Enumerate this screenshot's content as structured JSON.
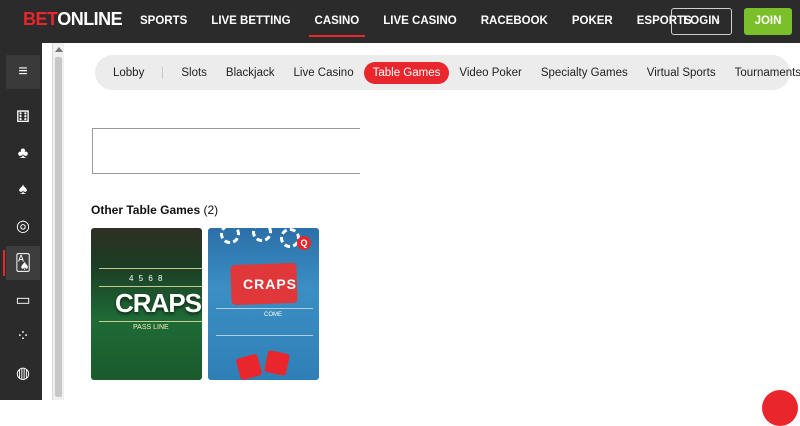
{
  "brand": {
    "bet": "BET",
    "online": "ONLINE",
    "accent": "#e8262c",
    "join_color": "#7bc02a"
  },
  "nav": {
    "items": [
      {
        "label": "SPORTS"
      },
      {
        "label": "LIVE BETTING"
      },
      {
        "label": "CASINO",
        "active": true
      },
      {
        "label": "LIVE CASINO"
      },
      {
        "label": "RACEBOOK"
      },
      {
        "label": "POKER"
      },
      {
        "label": "ESPORTS"
      }
    ],
    "more": "›",
    "login": "LOGIN",
    "join": "JOIN"
  },
  "sidebar": {
    "items": [
      {
        "icon": "menu-icon",
        "glyph": "≡"
      },
      {
        "icon": "dice-icon",
        "glyph": "⚅"
      },
      {
        "icon": "cherries-icon",
        "glyph": "♣"
      },
      {
        "icon": "spade-icon",
        "glyph": "♠"
      },
      {
        "icon": "poker-chip-icon",
        "glyph": "◎"
      },
      {
        "icon": "cards-icon",
        "glyph": "🂡",
        "active": true
      },
      {
        "icon": "laptop-icon",
        "glyph": "▭"
      },
      {
        "icon": "dots-icon",
        "glyph": "⁘"
      },
      {
        "icon": "basketball-icon",
        "glyph": "◍"
      }
    ]
  },
  "categories": [
    {
      "label": "Lobby"
    },
    {
      "label": "Slots"
    },
    {
      "label": "Blackjack"
    },
    {
      "label": "Live Casino"
    },
    {
      "label": "Table Games",
      "active": true
    },
    {
      "label": "Video Poker"
    },
    {
      "label": "Specialty Games"
    },
    {
      "label": "Virtual Sports"
    },
    {
      "label": "Tournaments"
    }
  ],
  "section": {
    "title": "Other Table Games",
    "count": "(2)"
  },
  "games": [
    {
      "title": "CRAPS",
      "nums": "4 5 6 8",
      "pass_line": "PASS LINE"
    },
    {
      "title": "CRAPS",
      "come": "COME",
      "badge": "Q"
    }
  ]
}
